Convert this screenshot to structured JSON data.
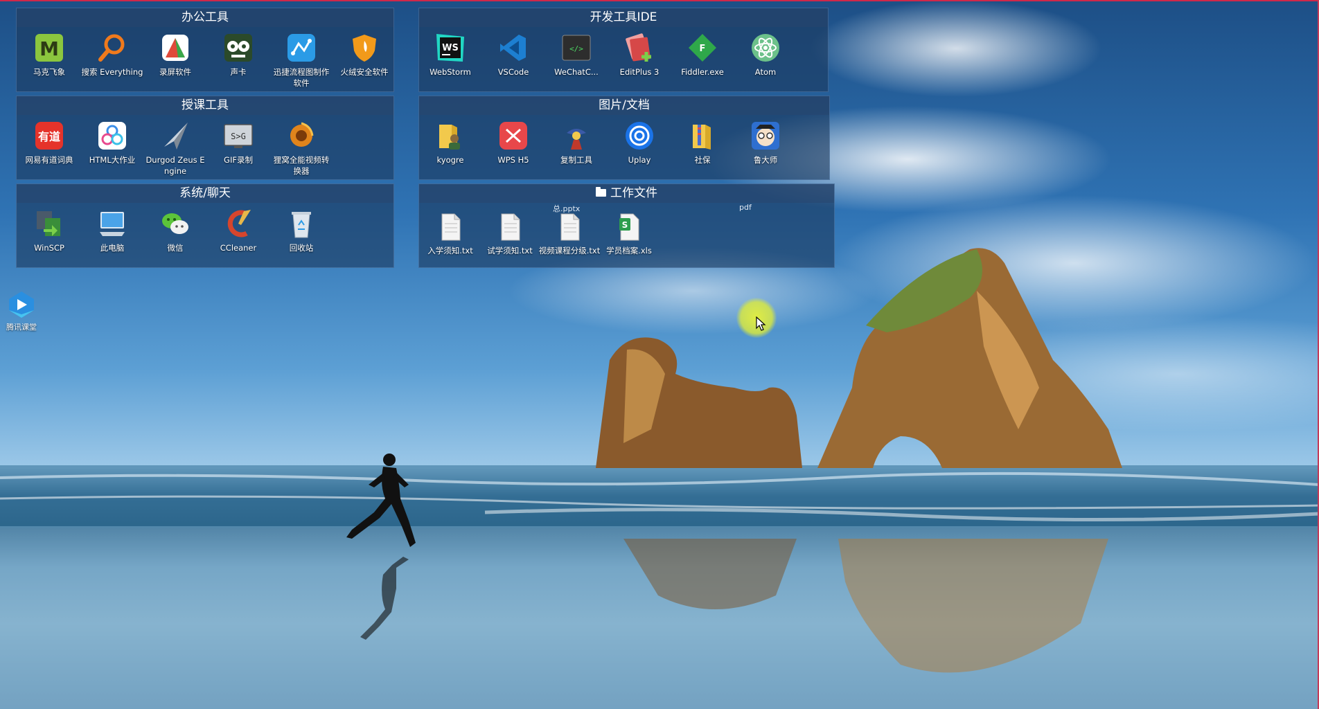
{
  "fences": {
    "office": {
      "title": "办公工具",
      "items": [
        {
          "label": "马克飞象",
          "icon": "markdown-m-icon",
          "color": "#8bc63e"
        },
        {
          "label": "搜索 Everything",
          "icon": "magnifier-icon",
          "color": "#f07a1c"
        },
        {
          "label": "录屏软件",
          "icon": "screen-recorder-icon",
          "color": "#e04a3a"
        },
        {
          "label": "声卡",
          "icon": "sound-card-icon",
          "color": "#2b4a2a"
        },
        {
          "label": "迅捷流程图制作软件",
          "icon": "flowchart-icon",
          "color": "#2b9be6"
        },
        {
          "label": "火绒安全软件",
          "icon": "shield-icon",
          "color": "#f29a1a"
        }
      ]
    },
    "dev": {
      "title": "开发工具IDE",
      "items": [
        {
          "label": "WebStorm",
          "icon": "webstorm-icon",
          "color": "#1b1b1b"
        },
        {
          "label": "VSCode",
          "icon": "vscode-icon",
          "color": "#1d7fd1"
        },
        {
          "label": "WeChatC...",
          "icon": "wechat-devtools-icon",
          "color": "#2d2d2d"
        },
        {
          "label": "EditPlus 3",
          "icon": "editplus-icon",
          "color": "#d64848"
        },
        {
          "label": "Fiddler.exe",
          "icon": "fiddler-icon",
          "color": "#2fa84a"
        },
        {
          "label": "Atom",
          "icon": "atom-icon",
          "color": "#6cc18a"
        }
      ]
    },
    "teaching": {
      "title": "授课工具",
      "items": [
        {
          "label": "网易有道词典",
          "icon": "youdao-icon",
          "color": "#e5332a"
        },
        {
          "label": "HTML大作业",
          "icon": "html-project-icon",
          "color": "#3b8ee8"
        },
        {
          "label": "Durgod Zeus Engine",
          "icon": "durgod-icon",
          "color": "#c9d2dc"
        },
        {
          "label": "GIF录制",
          "icon": "gif-recorder-icon",
          "color": "#cfd4da"
        },
        {
          "label": "狸窝全能视频转换器",
          "icon": "video-converter-icon",
          "color": "#e0841c"
        }
      ]
    },
    "images": {
      "title": "图片/文档",
      "items": [
        {
          "label": "kyogre",
          "icon": "folder-person-icon",
          "color": "#f2c94c"
        },
        {
          "label": "WPS H5",
          "icon": "wps-h5-icon",
          "color": "#e8474a"
        },
        {
          "label": "复制工具",
          "icon": "copy-tool-icon",
          "color": "#3a5aa8"
        },
        {
          "label": "Uplay",
          "icon": "uplay-icon",
          "color": "#1a73e8"
        },
        {
          "label": "社保",
          "icon": "folder-zip-icon",
          "color": "#f2c94c"
        },
        {
          "label": "鲁大师",
          "icon": "ludashi-icon",
          "color": "#2e6fd0"
        }
      ]
    },
    "system": {
      "title": "系统/聊天",
      "items": [
        {
          "label": "WinSCP",
          "icon": "winscp-icon",
          "color": "#3a8e3a"
        },
        {
          "label": "此电脑",
          "icon": "computer-icon",
          "color": "#4aa3e8"
        },
        {
          "label": "微信",
          "icon": "wechat-icon",
          "color": "#5cc43a"
        },
        {
          "label": "CCleaner",
          "icon": "ccleaner-icon",
          "color": "#d6452d"
        },
        {
          "label": "回收站",
          "icon": "recycle-bin-icon",
          "color": "#dfe6ee"
        }
      ]
    },
    "work": {
      "title": "工作文件",
      "overflow_left": "总.pptx",
      "overflow_right": "pdf",
      "items": [
        {
          "label": "入学须知.txt",
          "icon": "text-file-icon",
          "color": "#f4f4f4"
        },
        {
          "label": "试学须知.txt",
          "icon": "text-file-icon",
          "color": "#f4f4f4"
        },
        {
          "label": "视频课程分级.txt",
          "icon": "text-file-icon",
          "color": "#f4f4f4"
        },
        {
          "label": "学员档案.xls",
          "icon": "spreadsheet-file-icon",
          "color": "#2e9d4e"
        }
      ]
    }
  },
  "desktop": {
    "items": [
      {
        "label": "腾讯课堂",
        "icon": "tencent-classroom-icon",
        "color": "#2a8fe0"
      }
    ]
  }
}
